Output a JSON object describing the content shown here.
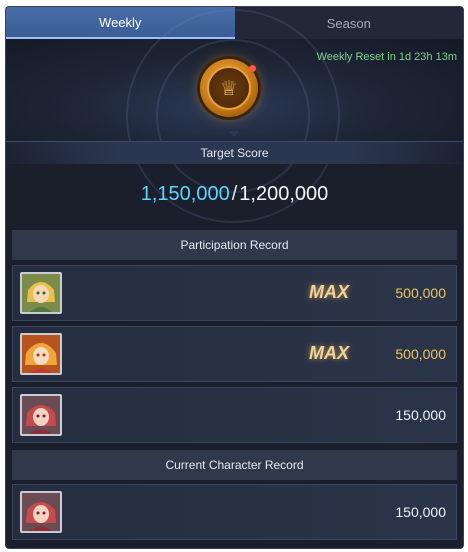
{
  "tabs": [
    {
      "label": "Weekly",
      "active": true
    },
    {
      "label": "Season",
      "active": false
    }
  ],
  "reset_text": "Weekly Reset in 1d 23h 13m",
  "target_label": "Target Score",
  "score": {
    "current": "1,150,000",
    "separator": "/",
    "target": "1,200,000"
  },
  "participation": {
    "title": "Participation Record",
    "rows": [
      {
        "max_label": "MAX",
        "value": "500,000"
      },
      {
        "max_label": "MAX",
        "value": "500,000"
      },
      {
        "max_label": "",
        "value": "150,000"
      }
    ]
  },
  "current": {
    "title": "Current Character Record",
    "rows": [
      {
        "value": "150,000"
      }
    ]
  },
  "colors": {
    "accent": "#5fd6ff",
    "gold": "#f0c460",
    "reset": "#7fd48a",
    "tab_active": "#4a6ea8"
  }
}
